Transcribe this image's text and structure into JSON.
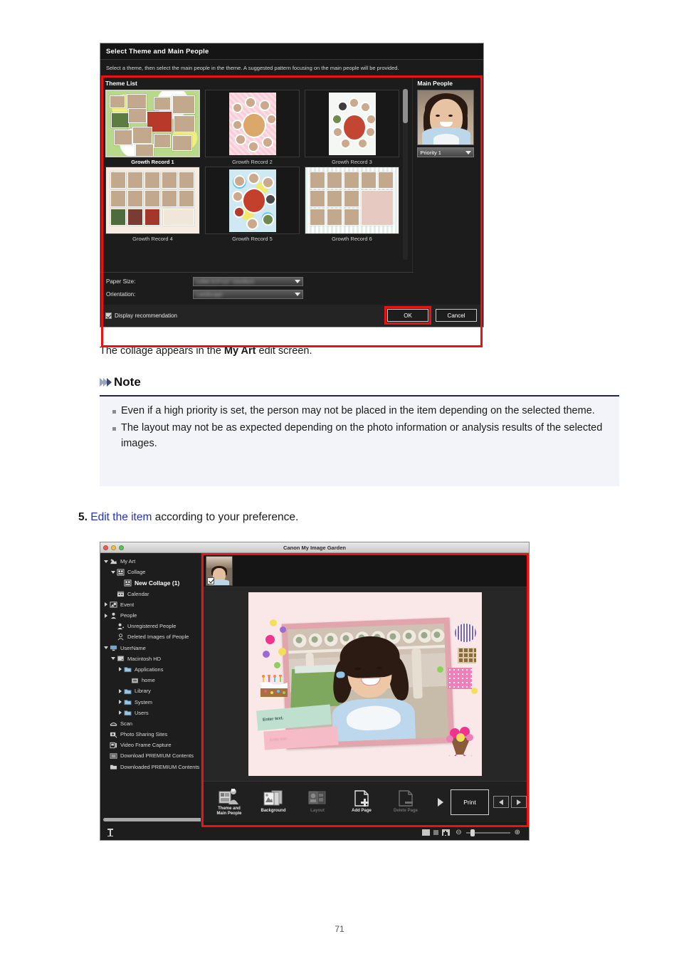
{
  "dialog": {
    "title": "Select Theme and Main People",
    "description": "Select a theme, then select the main people in the theme. A suggested pattern focusing on the main people will be provided.",
    "theme_list_label": "Theme List",
    "main_people_label": "Main People",
    "themes": [
      {
        "name": "Growth Record 1",
        "selected": true
      },
      {
        "name": "Growth Record 2",
        "selected": false
      },
      {
        "name": "Growth Record 3",
        "selected": false
      },
      {
        "name": "Growth Record 4",
        "selected": false
      },
      {
        "name": "Growth Record 5",
        "selected": false
      },
      {
        "name": "Growth Record 6",
        "selected": false
      }
    ],
    "priority_value": "Priority 1",
    "settings": [
      {
        "label": "Paper Size:",
        "value": "Letter 8.5\"x11\" 22x28cm"
      },
      {
        "label": "Orientation:",
        "value": "Landscape"
      }
    ],
    "checkbox_label": "Display recommendation",
    "checkbox_checked": true,
    "ok_label": "OK",
    "cancel_label": "Cancel",
    "highlight_color": "#ee1111"
  },
  "body_text": {
    "collage_sentence_pre": "The collage appears in the ",
    "collage_sentence_bold": "My Art",
    "collage_sentence_post": " edit screen.",
    "note_title": "Note",
    "note_items": [
      "Even if a high priority is set, the person may not be placed in the item depending on the selected theme.",
      "The layout may not be as expected depending on the photo information or analysis results of the selected images."
    ],
    "step_number": "5.",
    "step_link": "Edit the item",
    "step_rest": " according to your preference."
  },
  "window": {
    "title": "Canon My Image Garden",
    "sidebar": [
      {
        "label": "My Art",
        "indent": 0,
        "disclosure": "down",
        "icon": "my-art-icon",
        "selected": false
      },
      {
        "label": "Collage",
        "indent": 1,
        "disclosure": "down",
        "icon": "collage-icon",
        "selected": false
      },
      {
        "label": "New Collage (1)",
        "indent": 2,
        "disclosure": "none",
        "icon": "collage-item-icon",
        "selected": true
      },
      {
        "label": "Calendar",
        "indent": 1,
        "disclosure": "none",
        "icon": "calendar-icon",
        "selected": false
      },
      {
        "label": "Event",
        "indent": 0,
        "disclosure": "right",
        "icon": "event-icon",
        "selected": false
      },
      {
        "label": "People",
        "indent": 0,
        "disclosure": "right",
        "icon": "people-icon",
        "selected": false
      },
      {
        "label": "Unregistered People",
        "indent": 1,
        "disclosure": "none",
        "icon": "unregistered-people-icon",
        "selected": false
      },
      {
        "label": "Deleted Images of People",
        "indent": 1,
        "disclosure": "none",
        "icon": "deleted-people-icon",
        "selected": false
      },
      {
        "label": "UserName",
        "indent": 0,
        "disclosure": "down",
        "icon": "computer-icon",
        "selected": false
      },
      {
        "label": "Macintosh HD",
        "indent": 1,
        "disclosure": "down",
        "icon": "harddisk-icon",
        "selected": false
      },
      {
        "label": "Applications",
        "indent": 2,
        "disclosure": "right",
        "icon": "folder-icon",
        "selected": false
      },
      {
        "label": "home",
        "indent": 3,
        "disclosure": "none",
        "icon": "home-icon",
        "selected": false
      },
      {
        "label": "Library",
        "indent": 2,
        "disclosure": "right",
        "icon": "folder-icon",
        "selected": false
      },
      {
        "label": "System",
        "indent": 2,
        "disclosure": "right",
        "icon": "folder-icon",
        "selected": false
      },
      {
        "label": "Users",
        "indent": 2,
        "disclosure": "right",
        "icon": "folder-icon",
        "selected": false
      },
      {
        "label": "Scan",
        "indent": 0,
        "disclosure": "none",
        "icon": "scan-icon",
        "selected": false
      },
      {
        "label": "Photo Sharing Sites",
        "indent": 0,
        "disclosure": "none",
        "icon": "photo-sharing-icon",
        "selected": false
      },
      {
        "label": "Video Frame Capture",
        "indent": 0,
        "disclosure": "none",
        "icon": "video-frame-icon",
        "selected": false
      },
      {
        "label": "Download PREMIUM Contents",
        "indent": 0,
        "disclosure": "none",
        "icon": "download-premium-icon",
        "selected": false
      },
      {
        "label": "Downloaded PREMIUM Contents",
        "indent": 0,
        "disclosure": "none",
        "icon": "downloaded-premium-icon",
        "selected": false
      }
    ],
    "canvas": {
      "text_placeholder_green": "Enter text.",
      "text_placeholder_pink": "Enter text."
    },
    "toolbar": [
      {
        "label": "Theme and\nMain People",
        "icon": "theme-main-people-icon",
        "disabled": false
      },
      {
        "label": "Background",
        "icon": "background-icon",
        "disabled": false
      },
      {
        "label": "Layout",
        "icon": "layout-icon",
        "disabled": true
      },
      {
        "label": "Add Page",
        "icon": "add-page-icon",
        "disabled": false
      },
      {
        "label": "Delete Page",
        "icon": "delete-page-icon",
        "disabled": true
      }
    ],
    "print_label": "Print"
  },
  "page_number": "71"
}
